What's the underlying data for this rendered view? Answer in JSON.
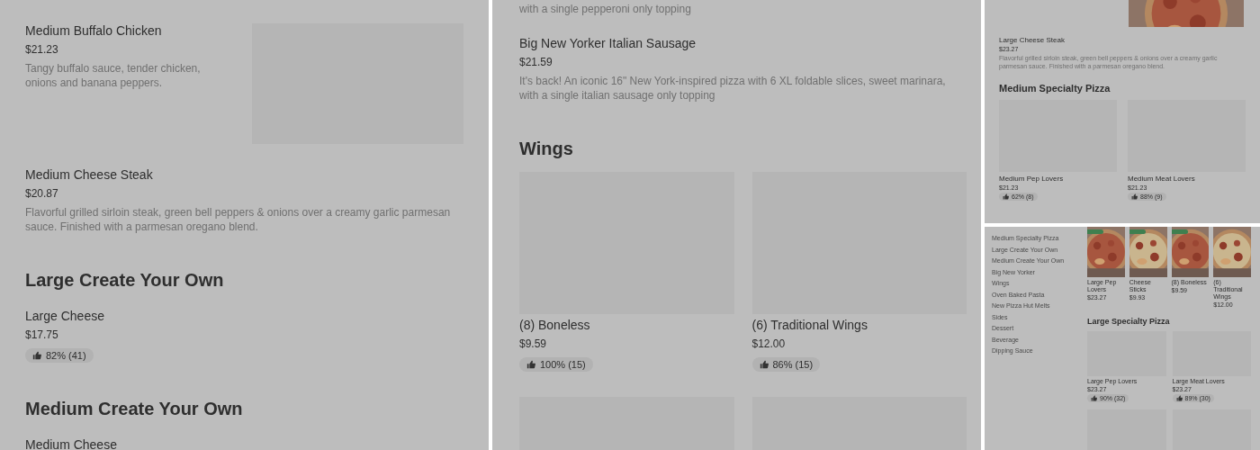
{
  "panels": [
    {
      "blocks": [
        {
          "kind": "item",
          "name": "Medium Buffalo Chicken",
          "price": "$21.23",
          "description": "Tangy buffalo sauce, tender chicken, onions and banana peppers.",
          "photo": false
        },
        {
          "kind": "item",
          "name": "Medium Cheese Steak",
          "price": "$20.87",
          "description": "Flavorful grilled sirloin steak, green bell peppers & onions over a creamy garlic parmesan sauce. Finished with a parmesan oregano blend."
        },
        {
          "kind": "heading",
          "text": "Large Create Your Own"
        },
        {
          "kind": "item",
          "name": "Large Cheese",
          "price": "$17.75",
          "rating": "82% (41)"
        },
        {
          "kind": "heading",
          "text": "Medium Create Your Own"
        },
        {
          "kind": "item",
          "name": "Medium Cheese"
        }
      ]
    },
    {
      "blocks": [
        {
          "kind": "text",
          "text": "with a single pepperoni only topping"
        },
        {
          "kind": "item",
          "name": "Big New Yorker Italian Sausage",
          "price": "$21.59",
          "description": "It's back! An iconic 16\" New York-inspired pizza with 6 XL foldable slices, sweet marinara, with a single italian sausage only topping"
        },
        {
          "kind": "heading",
          "text": "Wings"
        },
        {
          "kind": "cards",
          "cards": [
            {
              "name": "(8) Boneless",
              "price": "$9.59",
              "rating": "100% (15)",
              "photo": false
            },
            {
              "name": "(6) Traditional Wings",
              "price": "$12.00",
              "rating": "86% (15)",
              "photo": false
            },
            {
              "photo": false
            },
            {
              "photo": false
            }
          ]
        }
      ]
    },
    {
      "blocks": [
        {
          "kind": "item",
          "name": "Large Cheese Steak",
          "price": "$23.27",
          "description": "Flavorful grilled sirloin steak, green bell peppers & onions over a creamy garlic parmesan sauce. Finished with a parmesan oregano blend.",
          "photo": true
        },
        {
          "kind": "heading",
          "text": "Medium Specialty Pizza"
        },
        {
          "kind": "cards",
          "cards": [
            {
              "name": "Medium Pep Lovers",
              "price": "$21.23",
              "rating": "62% (8)",
              "photo": false
            },
            {
              "name": "Medium Meat Lovers",
              "price": "$21.23",
              "rating": "88% (9)",
              "photo": false
            }
          ]
        }
      ]
    },
    {
      "sidebar": [
        "Medium Specialty Pizza",
        "Large Create Your Own",
        "Medium Create Your Own",
        "Big New Yorker",
        "Wings",
        "Oven Baked Pasta",
        "New Pizza Hut Melts",
        "Sides",
        "Dessert",
        "Beverage",
        "Dipping Sauce"
      ],
      "blocks": [
        {
          "kind": "featured",
          "cards": [
            {
              "name": "Large Pep Lovers",
              "price": "$23.27",
              "photo": true,
              "deal": true
            },
            {
              "name": "Cheese Sticks",
              "price": "$9.93",
              "photo": true,
              "deal": true
            },
            {
              "name": "(8) Boneless",
              "price": "$9.59",
              "photo": true,
              "deal": true
            },
            {
              "name": "(6) Traditional Wings",
              "price": "$12.00",
              "photo": true,
              "deal": false
            }
          ]
        },
        {
          "kind": "heading",
          "text": "Large Specialty Pizza"
        },
        {
          "kind": "cards",
          "cards": [
            {
              "name": "Large Pep Lovers",
              "price": "$23.27",
              "rating": "90% (32)",
              "photo": false
            },
            {
              "name": "Large Meat Lovers",
              "price": "$23.27",
              "rating": "89% (30)",
              "photo": false
            },
            {
              "photo": false
            },
            {
              "photo": false
            }
          ]
        }
      ]
    }
  ]
}
